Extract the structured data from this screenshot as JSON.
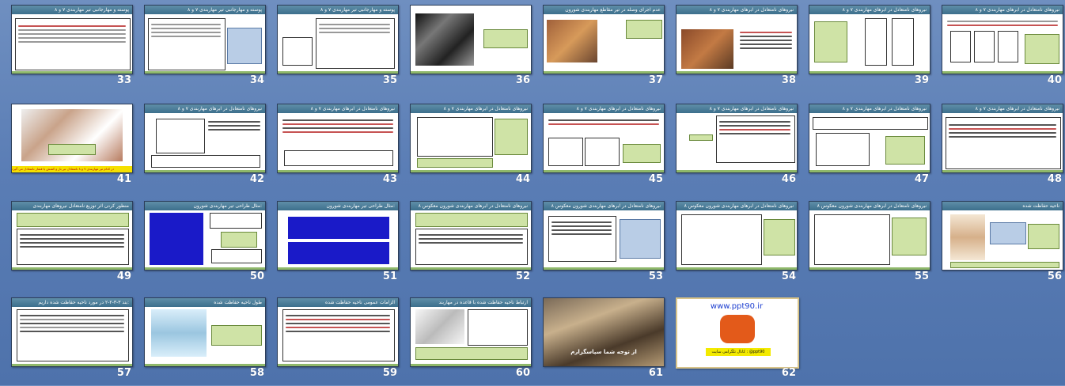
{
  "slides": [
    {
      "n": "40",
      "title": "نیروهای نامتعادل در ابرهای مهاربندی ۷ و ۸"
    },
    {
      "n": "39",
      "title": "نیروهای نامتعادل در ابرهای مهاربندی ۷ و ۸"
    },
    {
      "n": "38",
      "title": "نیروهای نامتعادل در ابرهای مهاربندی ۷ و ۸"
    },
    {
      "n": "37",
      "title": "عدم اجرای وصله در تیر مقاطع مهاربندی شورون"
    },
    {
      "n": "36",
      "title": ""
    },
    {
      "n": "35",
      "title": "پوسته و مهارجانبی تیر مهاربندی ۷ و ۸"
    },
    {
      "n": "34",
      "title": "پوسته و مهارجانبی تیر مهاربندی ۷ و ۸"
    },
    {
      "n": "33",
      "title": "پوسته و مهارجانبی تیر مهاربندی ۷ و ۸"
    },
    {
      "n": "48",
      "title": "نیروهای نامتعادل در ابرهای مهاربندی ۷ و ۸"
    },
    {
      "n": "47",
      "title": "نیروهای نامتعادل در ابرهای مهاربندی ۷ و ۸"
    },
    {
      "n": "46",
      "title": "نیروهای نامتعادل در ابرهای مهاربندی ۷ و ۸"
    },
    {
      "n": "45",
      "title": "نیروهای نامتعادل در ابرهای مهاربندی ۷ و ۸"
    },
    {
      "n": "44",
      "title": "نیروهای نامتعادل در ابرهای مهاربندی ۷ و ۸"
    },
    {
      "n": "43",
      "title": "نیروهای نامتعادل در ابرهای مهاربندی ۷ و ۸"
    },
    {
      "n": "42",
      "title": "نیروهای نامتعادل در ابرهای مهاربندی ۷ و ۸"
    },
    {
      "n": "41",
      "title": ""
    },
    {
      "n": "56",
      "title": "ناحیه حفاظت شده"
    },
    {
      "n": "55",
      "title": "نیروهای نامتعادل در ابرهای مهاربندی شورون معکوس ۸"
    },
    {
      "n": "54",
      "title": "نیروهای نامتعادل در ابرهای مهاربندی شورون معکوس ۸"
    },
    {
      "n": "53",
      "title": "نیروهای نامتعادل در ابرهای مهاربندی شورون معکوس ۸"
    },
    {
      "n": "52",
      "title": "نیروهای نامتعادل در ابرهای مهاربندی شورون معکوس ۸"
    },
    {
      "n": "51",
      "title": "مثال طراحی تیر مهاربندی شورون:"
    },
    {
      "n": "50",
      "title": "مثال طراحی تیر مهاربندی شورون:"
    },
    {
      "n": "49",
      "title": "منظور کردن اثر توزیع نامتعادل نیروهای مهاربندی"
    },
    {
      "n": "57",
      "title": "بند ۳-۳-۲-۲ در مورد ناحیه حفاظت شده داریم:"
    },
    {
      "n": "58",
      "title": "طول ناحیه حفاظت شده"
    },
    {
      "n": "59",
      "title": "الزامات عمومی ناحیه حفاظت شده"
    },
    {
      "n": "60",
      "title": "ارتباط ناحیه حفاظت شده با قاعده در مهاربند"
    },
    {
      "n": "61",
      "title": ""
    },
    {
      "n": "62",
      "title": ""
    }
  ],
  "slide41_caption": "در کدام تیر مهاربندی ۷ و ۸ نامتعادل تیر بار و کشش یا فشار نامتعادل می گیرد",
  "slide61_caption": "از توجه شما سپاسگزارم",
  "slide62_url": "www.ppt90.ir",
  "slide62_footer": "کانال تلگرامی سایت : @ppt90",
  "colors": {
    "background": "#5a7db5",
    "title_bar": "#4a7d98",
    "accent_green": "#cfe3a6",
    "accent_red": "#c65353"
  }
}
